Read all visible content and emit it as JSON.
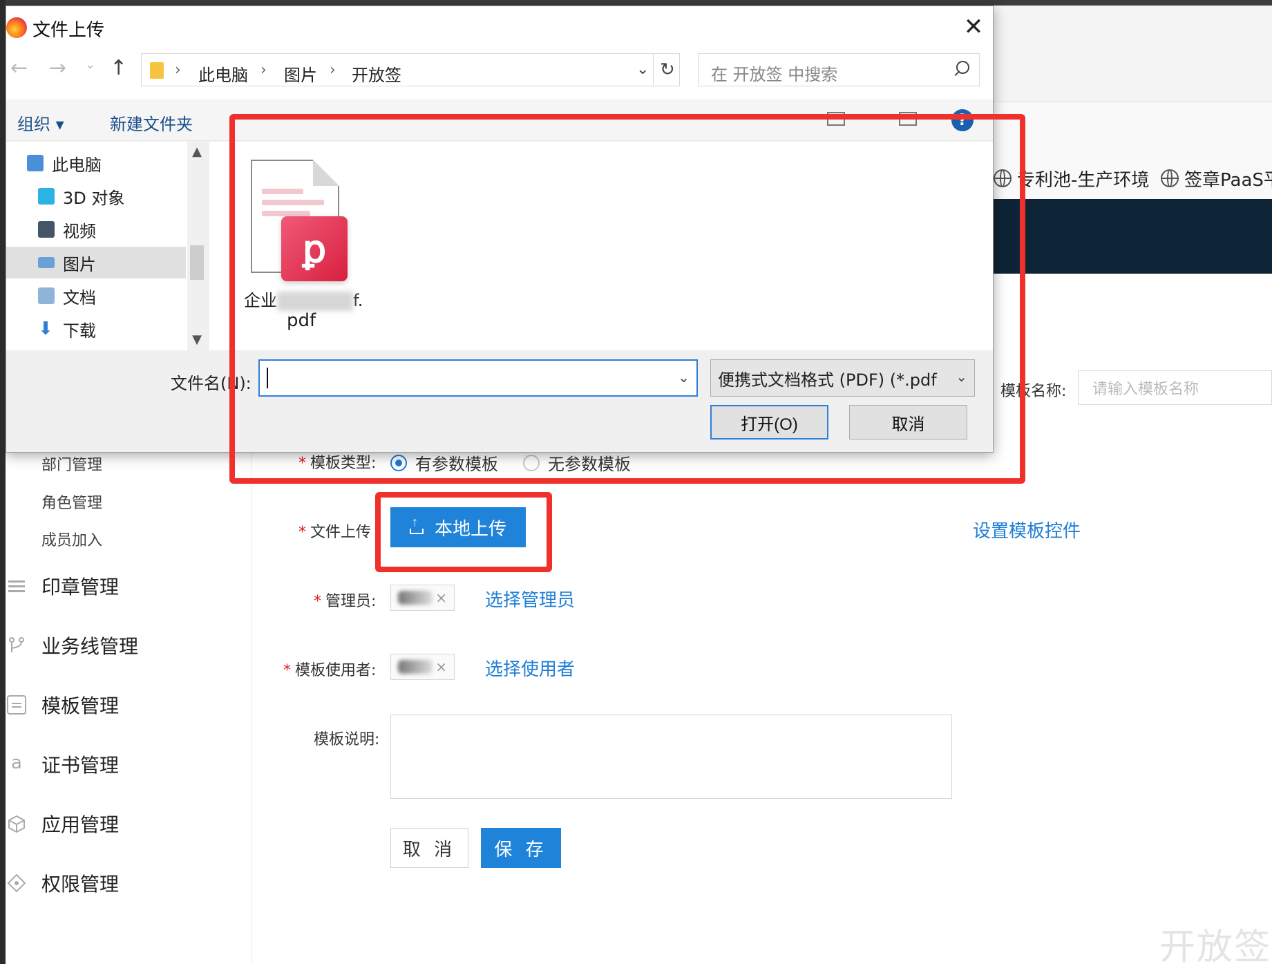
{
  "browser": {
    "bookmarks": [
      "专利池-生产环境",
      "签章PaaS平"
    ]
  },
  "sidebar": {
    "sub_items": [
      "部门管理",
      "角色管理",
      "成员加入"
    ],
    "menu_items": [
      {
        "label": "印章管理",
        "icon": "list-icon"
      },
      {
        "label": "业务线管理",
        "icon": "branch-icon"
      },
      {
        "label": "模板管理",
        "icon": "template-icon"
      },
      {
        "label": "证书管理",
        "icon": "certificate-icon"
      },
      {
        "label": "应用管理",
        "icon": "cube-icon"
      },
      {
        "label": "权限管理",
        "icon": "diamond-icon"
      }
    ]
  },
  "form": {
    "template_name_label": "模板名称:",
    "template_name_placeholder": "请输入模板名称",
    "template_type_label": "模板类型:",
    "template_type_options": [
      "有参数模板",
      "无参数模板"
    ],
    "template_type_selected": 0,
    "file_upload_label": "文件上传",
    "upload_button": "本地上传",
    "set_controls_link": "设置模板控件",
    "admin_label": "管理员:",
    "admin_tag_text": "孝",
    "select_admin_link": "选择管理员",
    "user_label": "模板使用者:",
    "user_tag_text": "李",
    "select_user_link": "选择使用者",
    "description_label": "模板说明:",
    "cancel_button": "取 消",
    "save_button": "保 存"
  },
  "dialog": {
    "title": "文件上传",
    "breadcrumb": [
      "此电脑",
      "图片",
      "开放签"
    ],
    "search_placeholder": "在 开放签 中搜索",
    "organize": "组织 ▾",
    "new_folder": "新建文件夹",
    "help": "?",
    "nav_items": [
      {
        "label": "此电脑",
        "icon": "computer-icon",
        "color": "#4a90d9"
      },
      {
        "label": "3D 对象",
        "icon": "cube-3d-icon",
        "color": "#2bb3e3"
      },
      {
        "label": "视频",
        "icon": "video-icon",
        "color": "#445566"
      },
      {
        "label": "图片",
        "icon": "pictures-icon",
        "color": "#6aa0d8",
        "selected": true
      },
      {
        "label": "文档",
        "icon": "documents-icon",
        "color": "#8fb3d9"
      },
      {
        "label": "下载",
        "icon": "download-icon",
        "color": "#2f7fd6"
      }
    ],
    "file": {
      "name_prefix": "企业",
      "name_suffix": "f.",
      "name_line2": "pdf"
    },
    "filename_label": "文件名(N):",
    "filetype": "便携式文档格式 (PDF)  (*.pdf",
    "open_button": "打开(O)",
    "cancel_button": "取消"
  },
  "watermark": "开放签",
  "colors": {
    "accent": "#1f83da",
    "annotation_red": "#f0302a",
    "dark_header": "#0c2436"
  }
}
